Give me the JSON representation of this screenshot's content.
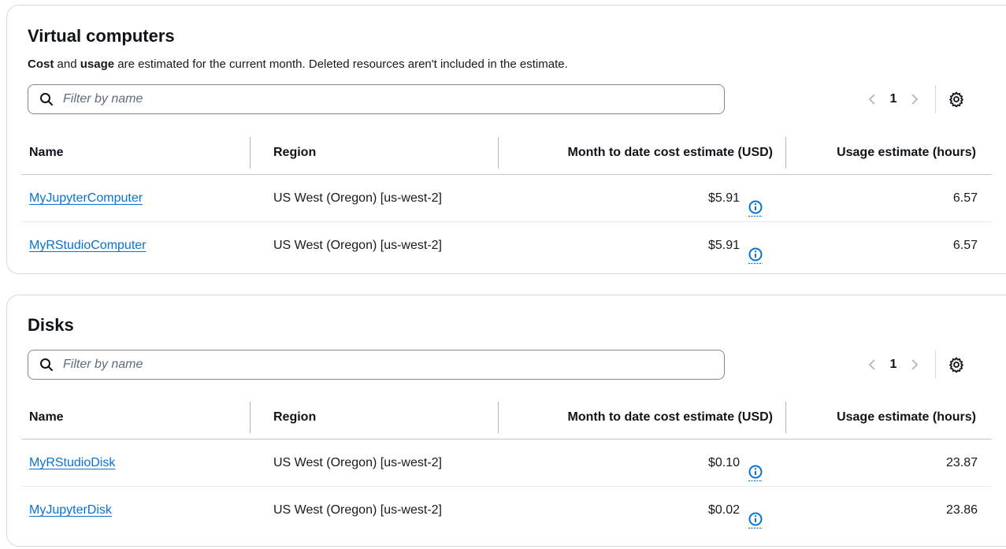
{
  "virtual_computers": {
    "title": "Virtual computers",
    "description_bold_1": "Cost",
    "description_mid": " and ",
    "description_bold_2": "usage",
    "description_rest": " are estimated for the current month. Deleted resources aren't included in the estimate.",
    "filter_placeholder": "Filter by name",
    "page": "1",
    "columns": [
      "Name",
      "Region",
      "Month to date cost estimate (USD)",
      "Usage estimate (hours)"
    ],
    "rows": [
      {
        "name": "MyJupyterComputer",
        "region": "US West (Oregon) [us-west-2]",
        "cost": "$5.91",
        "usage": "6.57"
      },
      {
        "name": "MyRStudioComputer",
        "region": "US West (Oregon) [us-west-2]",
        "cost": "$5.91",
        "usage": "6.57"
      }
    ]
  },
  "disks": {
    "title": "Disks",
    "filter_placeholder": "Filter by name",
    "page": "1",
    "columns": [
      "Name",
      "Region",
      "Month to date cost estimate (USD)",
      "Usage estimate (hours)"
    ],
    "rows": [
      {
        "name": "MyRStudioDisk",
        "region": "US West (Oregon) [us-west-2]",
        "cost": "$0.10",
        "usage": "23.87"
      },
      {
        "name": "MyJupyterDisk",
        "region": "US West (Oregon) [us-west-2]",
        "cost": "$0.02",
        "usage": "23.86"
      }
    ]
  },
  "icons": {
    "search": "search-icon",
    "prev": "chevron-left-icon",
    "next": "chevron-right-icon",
    "settings": "gear-icon",
    "info": "info-icon"
  },
  "colors": {
    "link": "#0972d3",
    "border": "#d5dbdb",
    "text": "#16191f"
  }
}
